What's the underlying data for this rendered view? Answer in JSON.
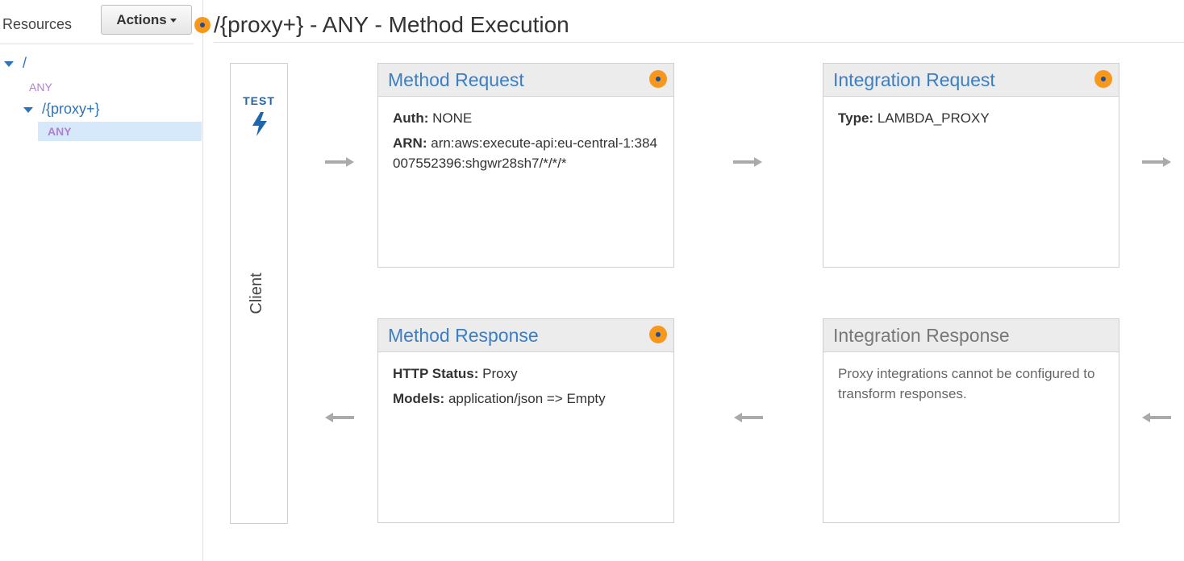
{
  "sidebar": {
    "title": "Resources",
    "actions_label": "Actions",
    "tree": {
      "root": "/",
      "root_method": "ANY",
      "child": "/{proxy+}",
      "child_method": "ANY"
    }
  },
  "page": {
    "title": "/{proxy+} - ANY - Method Execution"
  },
  "client": {
    "test_label": "TEST",
    "label": "Client"
  },
  "method_request": {
    "title": "Method Request",
    "auth_label": "Auth:",
    "auth_value": "NONE",
    "arn_label": "ARN:",
    "arn_value": "arn:aws:execute-api:eu-central-1:384007552396:shgwr28sh7/*/*/*"
  },
  "integration_request": {
    "title": "Integration Request",
    "type_label": "Type:",
    "type_value": "LAMBDA_PROXY"
  },
  "method_response": {
    "title": "Method Response",
    "status_label": "HTTP Status:",
    "status_value": "Proxy",
    "models_label": "Models:",
    "models_value": "application/json => Empty"
  },
  "integration_response": {
    "title": "Integration Response",
    "note": "Proxy integrations cannot be configured to transform responses."
  },
  "colors": {
    "accent_blue": "#3b7ec3",
    "dot_orange": "#f7981d",
    "method_purple": "#b37ed6",
    "selected_bg": "#d6e9fb"
  }
}
